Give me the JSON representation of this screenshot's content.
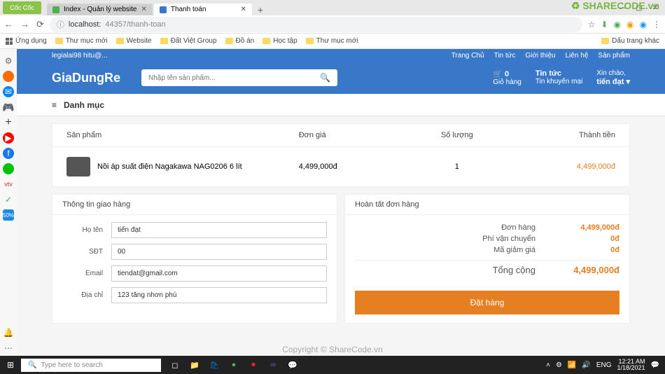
{
  "browser": {
    "logo": "Cốc Cốc",
    "tabs": [
      {
        "title": "Index - Quản lý website",
        "active": false
      },
      {
        "title": "Thanh toán",
        "active": true
      }
    ],
    "url_prefix": "localhost:",
    "url_rest": "44357/thanh-toan",
    "bookmarks_apps": "Ứng dụng",
    "bookmarks": [
      "Thư mục mới",
      "Website",
      "Đất Việt Group",
      "Đồ án",
      "Học tập",
      "Thư mục mới"
    ],
    "bookmarks_right": "Dấu trang khác"
  },
  "topstrip": {
    "left": "legialai98 hitu@...",
    "links": [
      "Trang Chủ",
      "Tin tức",
      "Giới thiệu",
      "Liên hệ",
      "Sản phẩm"
    ]
  },
  "header": {
    "brand": "GiaDungRe",
    "search_placeholder": "Nhập tên sản phẩm...",
    "cart_icon": "🛒",
    "cart_count": "0",
    "cart_label": "Giỏ hàng",
    "news_title": "Tin tức",
    "news_sub": "Tin khuyến mại",
    "greet": "Xin chào,",
    "user": "tiến đạt ▾"
  },
  "catbar": {
    "icon": "≡",
    "label": "Danh mục"
  },
  "table": {
    "headers": [
      "Sản phẩm",
      "Đơn giá",
      "Số lượng",
      "Thành tiền"
    ],
    "rows": [
      {
        "name": "Nồi áp suất điện Nagakawa NAG0206 6 lít",
        "price": "4,499,000đ",
        "qty": "1",
        "total": "4,499,000đ"
      }
    ]
  },
  "shipping": {
    "title": "Thông tin giao hàng",
    "fields": {
      "name_label": "Họ tên",
      "name_value": "tiến đạt",
      "phone_label": "SĐT",
      "phone_value": "00",
      "email_label": "Email",
      "email_value": "tiendat@gmail.com",
      "addr_label": "Địa chỉ",
      "addr_value": "123 tăng nhơn phú"
    }
  },
  "order": {
    "title": "Hoàn tất đơn hàng",
    "rows": [
      {
        "label": "Đơn hàng",
        "value": "4,499,000đ"
      },
      {
        "label": "Phí vận chuyển",
        "value": "0đ"
      },
      {
        "label": "Mã giảm giá",
        "value": "0đ"
      }
    ],
    "total_label": "Tổng cộng",
    "total_value": "4,499,000đ",
    "button": "Đặt hàng"
  },
  "watermark": {
    "top": "SHARECODE.vn",
    "center": "Copyright © ShareCode.vn"
  },
  "taskbar": {
    "search": "Type here to search",
    "lang": "ENG",
    "time": "12:21 AM",
    "date": "1/18/2021"
  }
}
